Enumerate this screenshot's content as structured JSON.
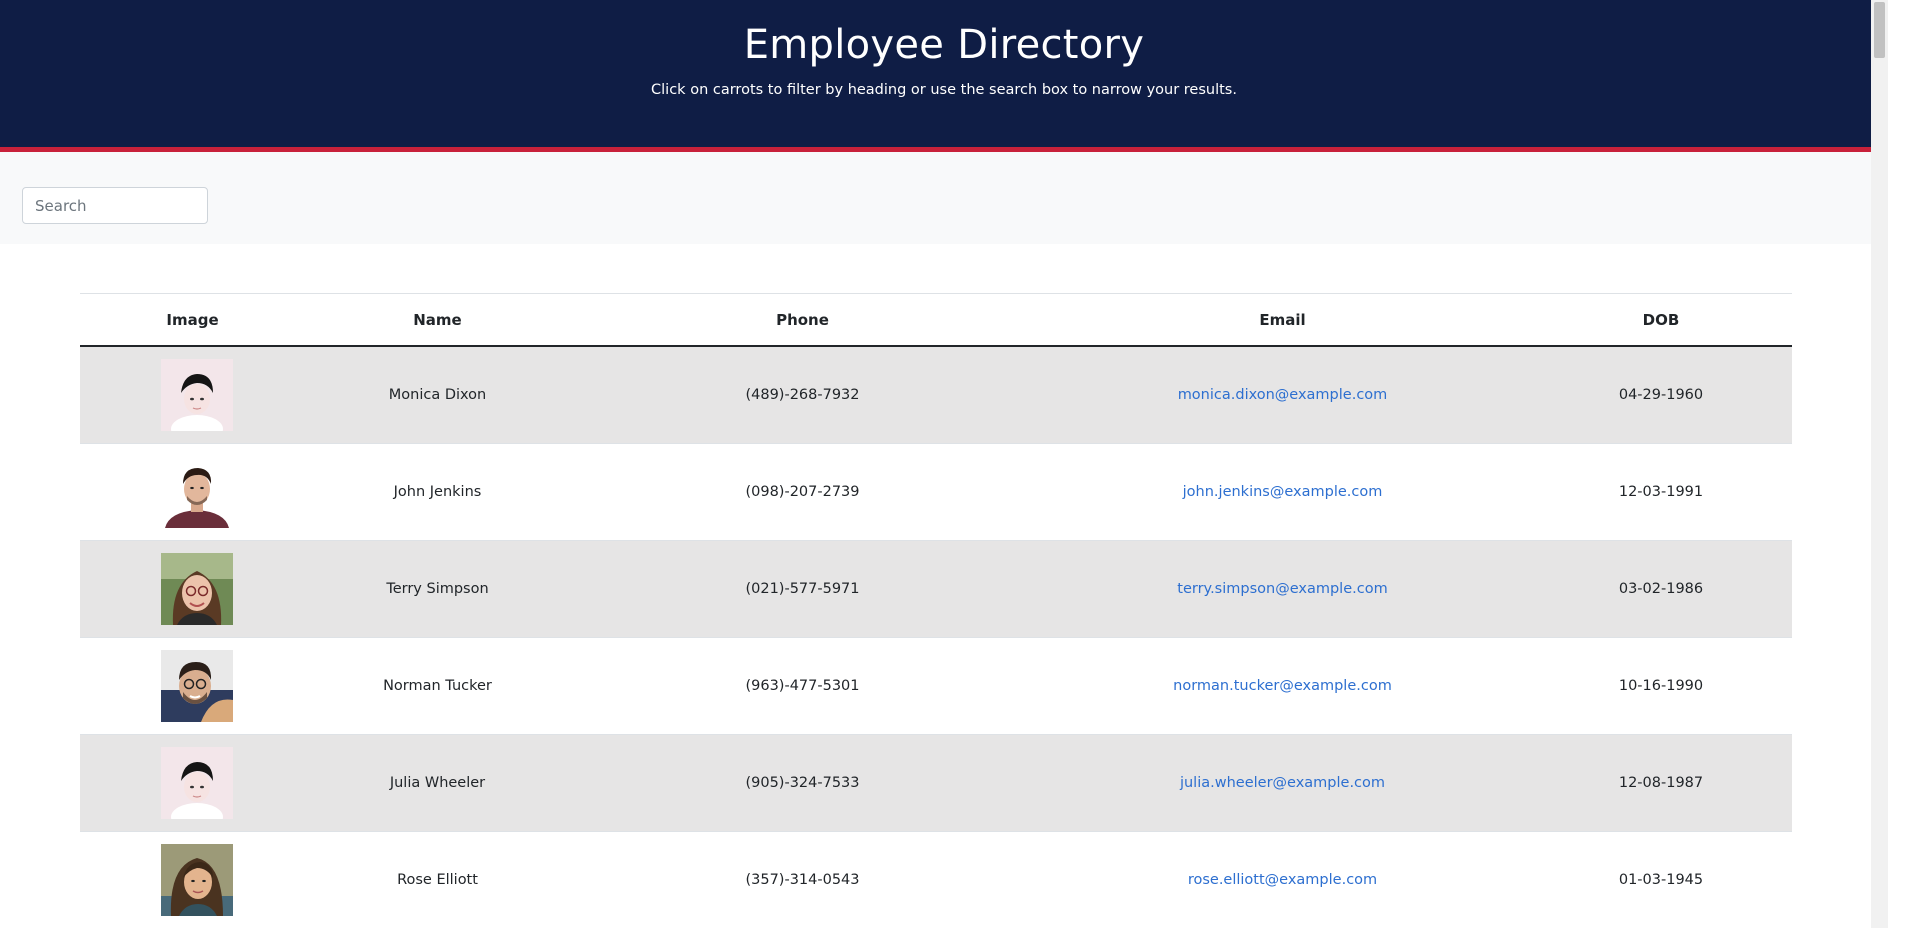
{
  "header": {
    "title": "Employee Directory",
    "subtitle": "Click on carrots to filter by heading or use the search box to narrow your results."
  },
  "search": {
    "placeholder": "Search",
    "value": ""
  },
  "table": {
    "columns": [
      "Image",
      "Name",
      "Phone",
      "Email",
      "DOB"
    ],
    "rows": [
      {
        "avatar": "avatar-dark-hair",
        "name": "Monica Dixon",
        "phone": "(489)-268-7932",
        "email": "monica.dixon@example.com",
        "dob": "04-29-1960"
      },
      {
        "avatar": "avatar-man-maroon",
        "name": "John Jenkins",
        "phone": "(098)-207-2739",
        "email": "john.jenkins@example.com",
        "dob": "12-03-1991"
      },
      {
        "avatar": "avatar-woman-glasses",
        "name": "Terry Simpson",
        "phone": "(021)-577-5971",
        "email": "terry.simpson@example.com",
        "dob": "03-02-1986"
      },
      {
        "avatar": "avatar-man-glasses",
        "name": "Norman Tucker",
        "phone": "(963)-477-5301",
        "email": "norman.tucker@example.com",
        "dob": "10-16-1990"
      },
      {
        "avatar": "avatar-dark-hair",
        "name": "Julia Wheeler",
        "phone": "(905)-324-7533",
        "email": "julia.wheeler@example.com",
        "dob": "12-08-1987"
      },
      {
        "avatar": "avatar-woman-outdoor",
        "name": "Rose Elliott",
        "phone": "(357)-314-0543",
        "email": "rose.elliott@example.com",
        "dob": "01-03-1945"
      }
    ]
  },
  "colors": {
    "header_bg": "#0f1d45",
    "accent_red": "#c8213a",
    "stripe": "#e6e5e5",
    "link": "#2d6fd0"
  }
}
